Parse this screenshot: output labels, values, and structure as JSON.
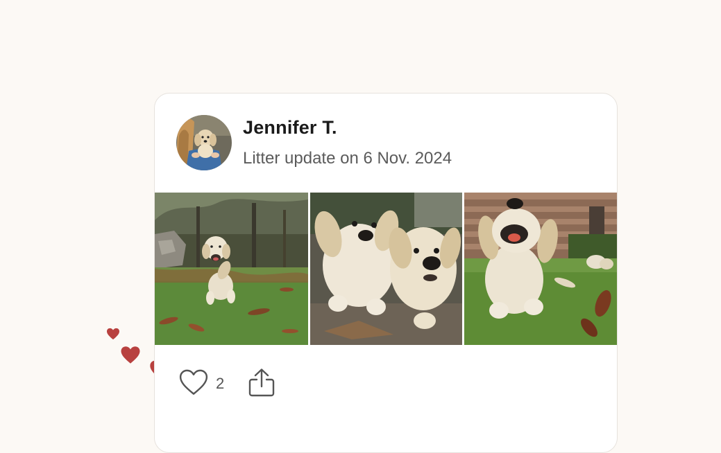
{
  "post": {
    "author": "Jennifer T.",
    "subtitle": "Litter update on 6 Nov. 2024",
    "avatar": "avatar-woman-holding-puppy",
    "photos": [
      {
        "subject": "puppy-running-in-leaves"
      },
      {
        "subject": "two-puppies-close-up"
      },
      {
        "subject": "puppy-running-on-grass"
      }
    ]
  },
  "actions": {
    "like_count": "2",
    "like_icon": "heart-outline-icon",
    "share_icon": "share-icon"
  },
  "colors": {
    "background": "#fcf9f5",
    "heart": "#b8413f",
    "text_primary": "#1a1a1a",
    "text_secondary": "#5b5b5b"
  }
}
